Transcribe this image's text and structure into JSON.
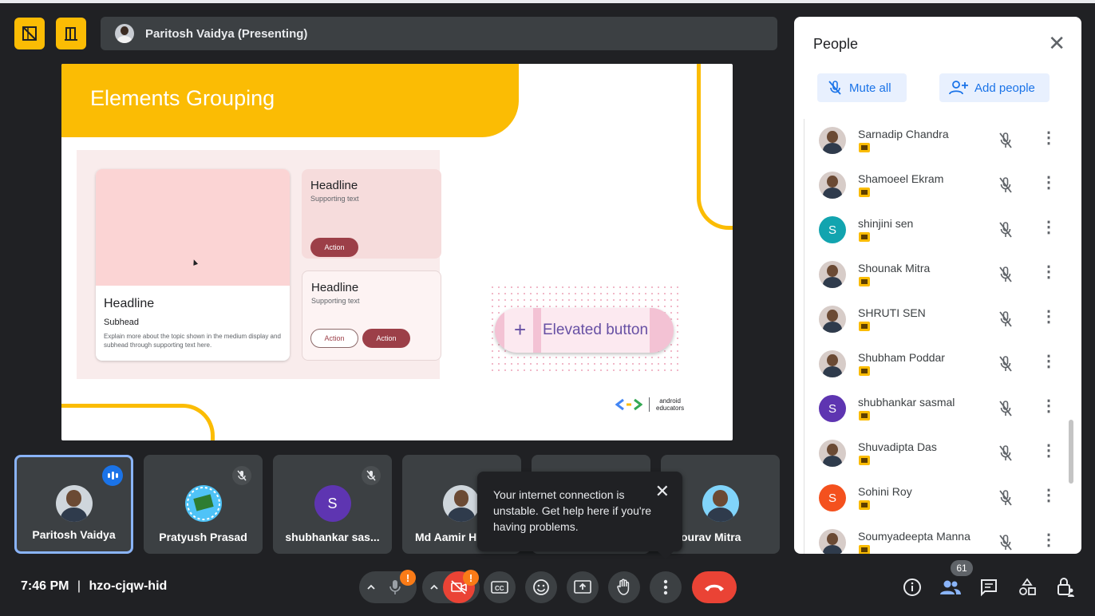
{
  "header": {
    "presenter_label": "Paritosh Vaidya (Presenting)",
    "buttons": [
      "layout-icon",
      "door-icon"
    ]
  },
  "slide": {
    "title": "Elements Grouping",
    "card_big": {
      "headline": "Headline",
      "subhead": "Subhead",
      "body": "Explain more about the topic shown in the medium display and subhead through supporting text here."
    },
    "card_a": {
      "headline": "Headline",
      "supporting": "Supporting text",
      "action": "Action"
    },
    "card_b": {
      "headline": "Headline",
      "supporting": "Supporting text",
      "action_outline": "Action",
      "action_filled": "Action"
    },
    "elevated_button": {
      "icon": "+",
      "label": "Elevated button"
    },
    "logo_text": "android\neducators"
  },
  "tiles": [
    {
      "name": "Paritosh Vaidya",
      "speaking": true
    },
    {
      "name": "Pratyush Prasad",
      "muted": true
    },
    {
      "name": "shubhankar sas...",
      "initial": "S",
      "muted": true
    },
    {
      "name": "Md Aamir H"
    },
    {
      "name": ""
    },
    {
      "name": "ourav Mitra"
    }
  ],
  "tooltip": {
    "message": "Your internet connection is unstable. Get help here if you're having problems.",
    "close": "✕"
  },
  "people_panel": {
    "title": "People",
    "close": "✕",
    "mute_all": "Mute all",
    "add_people": "Add people",
    "participants": [
      {
        "name": "Sarnadip Chandra"
      },
      {
        "name": "Shamoeel Ekram"
      },
      {
        "name": "shinjini sen",
        "initial": "S",
        "color": "#12a4af"
      },
      {
        "name": "Shounak Mitra"
      },
      {
        "name": "SHRUTI SEN"
      },
      {
        "name": "Shubham Poddar"
      },
      {
        "name": "shubhankar sasmal",
        "initial": "S",
        "color": "#5e35b1"
      },
      {
        "name": "Shuvadipta Das"
      },
      {
        "name": "Sohini Roy",
        "initial": "S",
        "color": "#f4511e"
      },
      {
        "name": "Soumyadeepta Manna"
      }
    ]
  },
  "bottom_bar": {
    "time": "7:46 PM",
    "separator": "|",
    "meeting_code": "hzo-cjqw-hid",
    "participant_count": "61",
    "mic_warning": "!",
    "cam_warning": "!"
  },
  "colors": {
    "accent_yellow": "#fbbc04",
    "panel_blue": "#1a73e8",
    "hangup_red": "#ea4335",
    "bg": "#202124"
  }
}
